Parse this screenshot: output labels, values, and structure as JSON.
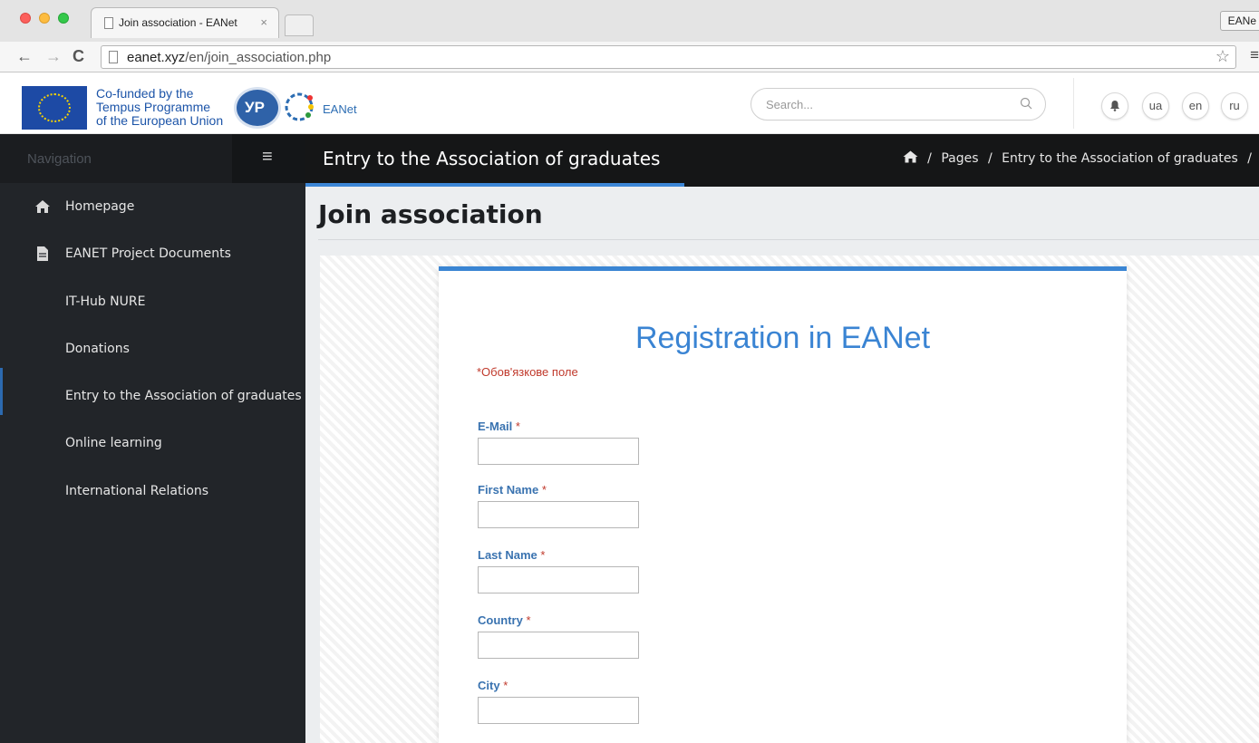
{
  "browser": {
    "tab_title": "Join association - EANet",
    "tab_close": "×",
    "profile_label": "EANe",
    "url_host": "eanet.xyz",
    "url_path": "/en/join_association.php"
  },
  "header": {
    "cofund_line1": "Co-funded by the",
    "cofund_line2": "Tempus Programme",
    "cofund_line3": "of the European Union",
    "site_label": "EANet",
    "search_placeholder": "Search...",
    "lang_ua": "ua",
    "lang_en": "en",
    "lang_ru": "ru"
  },
  "sidebar": {
    "title": "Navigation",
    "items": [
      {
        "label": "Homepage",
        "icon": "home-icon"
      },
      {
        "label": "EANET Project Documents",
        "icon": "document-icon"
      },
      {
        "label": "IT-Hub NURE"
      },
      {
        "label": "Donations"
      },
      {
        "label": "Entry to the Association of graduates",
        "active": true
      },
      {
        "label": "Online learning"
      },
      {
        "label": "International Relations"
      }
    ]
  },
  "content": {
    "page_bar_title": "Entry to the Association of graduates",
    "breadcrumb": [
      "/",
      "Pages",
      "/",
      "Entry to the Association of graduates",
      "/"
    ],
    "heading": "Join association"
  },
  "form": {
    "title": "Registration in EANet",
    "required_note": "*Обов'язкове поле",
    "asterisk": "*",
    "fields": [
      {
        "label": "E-Mail",
        "value": ""
      },
      {
        "label": "First Name",
        "value": ""
      },
      {
        "label": "Last Name",
        "value": ""
      },
      {
        "label": "Country",
        "value": ""
      },
      {
        "label": "City",
        "value": ""
      }
    ]
  },
  "colors": {
    "accent": "#3a84d3",
    "sidebar_bg": "#222529",
    "required": "#c0392b"
  }
}
